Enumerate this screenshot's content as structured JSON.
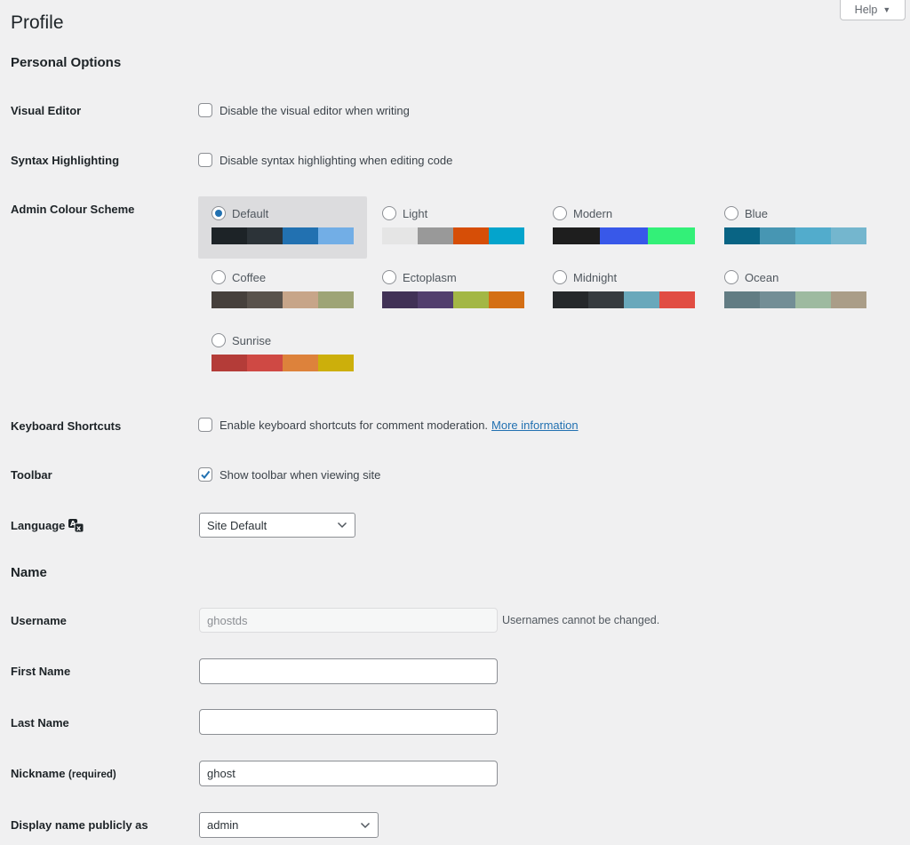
{
  "header": {
    "title": "Profile",
    "help_label": "Help",
    "help_icon": "triangle-down"
  },
  "personal_options": {
    "heading": "Personal Options",
    "visual_editor": {
      "label": "Visual Editor",
      "text": "Disable the visual editor when writing",
      "checked": false
    },
    "syntax_highlighting": {
      "label": "Syntax Highlighting",
      "text": "Disable syntax highlighting when editing code",
      "checked": false
    },
    "admin_colour_scheme": {
      "label": "Admin Colour Scheme",
      "selected": "Default",
      "schemes": [
        {
          "name": "Default",
          "colors": [
            "#1d2327",
            "#2c3338",
            "#2271b1",
            "#72aee6"
          ]
        },
        {
          "name": "Light",
          "colors": [
            "#e5e5e5",
            "#999999",
            "#d64e07",
            "#04a4cc"
          ]
        },
        {
          "name": "Modern",
          "colors": [
            "#1e1e1e",
            "#3858e9",
            "#33f078"
          ]
        },
        {
          "name": "Blue",
          "colors": [
            "#096484",
            "#4796b3",
            "#52accc",
            "#74b6ce"
          ]
        },
        {
          "name": "Coffee",
          "colors": [
            "#46403c",
            "#59524c",
            "#c7a589",
            "#9ea476"
          ]
        },
        {
          "name": "Ectoplasm",
          "colors": [
            "#413256",
            "#523f6d",
            "#a3b745",
            "#d46f15"
          ]
        },
        {
          "name": "Midnight",
          "colors": [
            "#25282b",
            "#363b3f",
            "#69a8bb",
            "#e14d43"
          ]
        },
        {
          "name": "Ocean",
          "colors": [
            "#627c83",
            "#738e96",
            "#9ebaa0",
            "#aa9d88"
          ]
        },
        {
          "name": "Sunrise",
          "colors": [
            "#b43c38",
            "#cf4944",
            "#dd823b",
            "#ccaf0b"
          ]
        }
      ]
    },
    "keyboard_shortcuts": {
      "label": "Keyboard Shortcuts",
      "text": "Enable keyboard shortcuts for comment moderation.",
      "link": "More information",
      "checked": false
    },
    "toolbar": {
      "label": "Toolbar",
      "text": "Show toolbar when viewing site",
      "checked": true
    },
    "language": {
      "label": "Language",
      "icon": "translation-icon",
      "value": "Site Default"
    }
  },
  "name_section": {
    "heading": "Name",
    "username": {
      "label": "Username",
      "value": "ghostds",
      "note": "Usernames cannot be changed."
    },
    "first_name": {
      "label": "First Name",
      "value": ""
    },
    "last_name": {
      "label": "Last Name",
      "value": ""
    },
    "nickname": {
      "label": "Nickname",
      "required": "(required)",
      "value": "ghost"
    },
    "display_name": {
      "label": "Display name publicly as",
      "value": "admin"
    }
  },
  "colors": {
    "accent": "#2271b1",
    "background": "#f0f0f1"
  }
}
